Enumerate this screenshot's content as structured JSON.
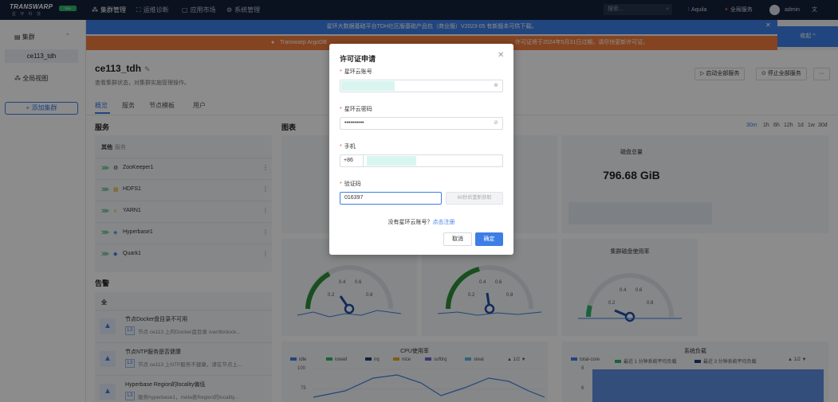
{
  "topbar": {
    "logo_text": "TRANSWARP",
    "logo_sub": "星 环 科 技",
    "logo_badge": "TDH",
    "nav": [
      {
        "label": "集群管理",
        "icon": "cluster-icon"
      },
      {
        "label": "运维诊断",
        "icon": "diagnose-icon"
      },
      {
        "label": "应用市场",
        "icon": "market-icon"
      },
      {
        "label": "系统管理",
        "icon": "system-icon"
      }
    ],
    "search_placeholder": "搜索...",
    "aquila": "Aquila",
    "global_service": "全局服务",
    "user": "admin"
  },
  "banners": {
    "blue": "星环大数据基础平台TDH社区版基础产品包（商业版）V2023-05 有新版本可供下载。",
    "orange": "Transwarp ArgoDB",
    "orange_tail": "许可证将于2024年5月31日过期，请尽快更新许可证。",
    "collapse": "收起 ^"
  },
  "sidebar": {
    "cluster_label": "集群",
    "cluster_item": "ce113_tdh",
    "all_clusters": "全局视图",
    "add_cluster": "+ 添加集群"
  },
  "main": {
    "cluster_name": "ce113_tdh",
    "description": "查看集群状态，对集群实施管理操作。",
    "start_all": "启动全部服务",
    "stop_all": "停止全部服务",
    "more": "···",
    "tabs": [
      "概览",
      "服务",
      "节点模板",
      "用户"
    ],
    "services_title": "服务",
    "services_head": "其他",
    "services_head_sub": "服务",
    "services": [
      {
        "name": "ZooKeeper1",
        "icon": "zookeeper-icon",
        "glyph": "⚙"
      },
      {
        "name": "HDFS1",
        "icon": "hdfs-icon",
        "glyph": "▦"
      },
      {
        "name": "YARN1",
        "icon": "yarn-icon",
        "glyph": "⋏"
      },
      {
        "name": "Hyperbase1",
        "icon": "hyperbase-icon",
        "glyph": "◈"
      },
      {
        "name": "Quark1",
        "icon": "quark-icon",
        "glyph": "◆"
      }
    ],
    "alerts_title": "告警",
    "alerts_head": "全",
    "alerts": [
      {
        "title": "节点Docker盘目录不可用",
        "level": "L3",
        "desc": "节点 ce113 上的Docker盘目录 /var/lib/dock..."
      },
      {
        "title": "节点NTP服务是否健康",
        "level": "L3",
        "desc": "节点 ce113 上NTP服务不健康，请在节点上..."
      },
      {
        "title": "Hyperbase Region的locality偏低",
        "level": "L3",
        "desc": "服务hyperbase1，meta表Region的locality..."
      }
    ],
    "charts_title": "图表",
    "ranges": [
      "30m",
      "1h",
      "6h",
      "12h",
      "1d",
      "1w",
      "30d"
    ],
    "disk_total_title": "磁盘总量",
    "disk_total_value": "796.68 GiB",
    "disk_usage_title": "集群磁盘使用率",
    "gauge_ticks": [
      "0.2",
      "0.4",
      "0.6",
      "0.8"
    ],
    "cpu_title": "CPU使用率",
    "cpu_legend": [
      "idle",
      "iowait",
      "irq",
      "nice",
      "softirq",
      "steal"
    ],
    "cpu_page": "1/2",
    "load_title": "系统负载",
    "load_legend": [
      "total-core",
      "最近 1 分钟系统平均负载",
      "最近 3 分钟系统平均负载"
    ],
    "load_page": "1/2",
    "cpu_y": [
      "100",
      "75"
    ],
    "load_y": [
      "8",
      "6"
    ]
  },
  "modal": {
    "title": "许可证申请",
    "account_label": "星环云账号",
    "password_label": "星环云密码",
    "password_value": "••••••••••",
    "phone_label": "手机",
    "phone_prefix": "+86",
    "code_label": "验证码",
    "code_value": "016397",
    "code_button": "60秒后重新获取",
    "no_account": "没有星环云账号？",
    "register_link": "点击注册",
    "cancel": "取消",
    "confirm": "确定"
  },
  "colors": {
    "accent": "#3d7ee6",
    "topbar": "#15213a",
    "banner_orange": "#f07d3d",
    "ok_green": "#2fb36a"
  }
}
